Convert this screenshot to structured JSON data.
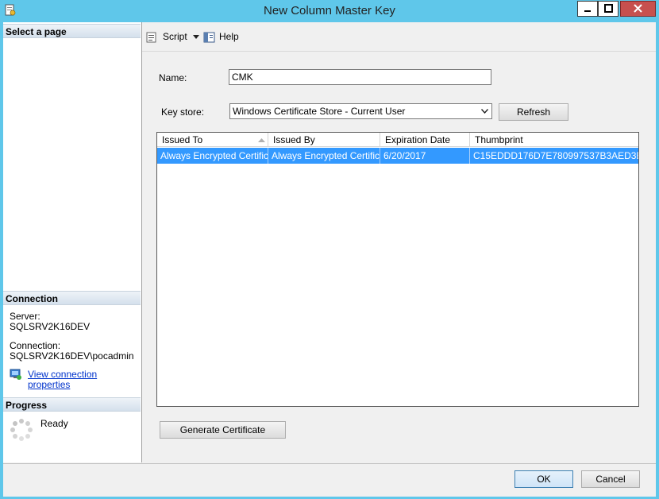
{
  "window": {
    "title": "New Column Master Key"
  },
  "left_pane": {
    "select_page_header": "Select a page",
    "connection_header": "Connection",
    "server_label": "Server:",
    "server_value": "SQLSRV2K16DEV",
    "connection_label": "Connection:",
    "connection_value": "SQLSRV2K16DEV\\pocadmin",
    "view_properties_link": "View connection properties",
    "progress_header": "Progress",
    "progress_status": "Ready"
  },
  "toolbar": {
    "script_label": "Script",
    "help_label": "Help"
  },
  "form": {
    "name_label": "Name:",
    "name_value": "CMK",
    "key_store_label": "Key store:",
    "key_store_value": "Windows Certificate Store - Current User",
    "refresh_label": "Refresh"
  },
  "table": {
    "columns": [
      "Issued To",
      "Issued By",
      "Expiration Date",
      "Thumbprint"
    ],
    "rows": [
      [
        "Always Encrypted Certific...",
        "Always Encrypted Certific...",
        "6/20/2017",
        "C15EDDD176D7E780997537B3AED3E..."
      ]
    ]
  },
  "generate_certificate_label": "Generate Certificate",
  "footer": {
    "ok_label": "OK",
    "cancel_label": "Cancel"
  },
  "colors": {
    "title_bar": "#5fc7ea",
    "selection": "#3399ff",
    "close_button": "#c7504e",
    "link": "#0033cc"
  }
}
